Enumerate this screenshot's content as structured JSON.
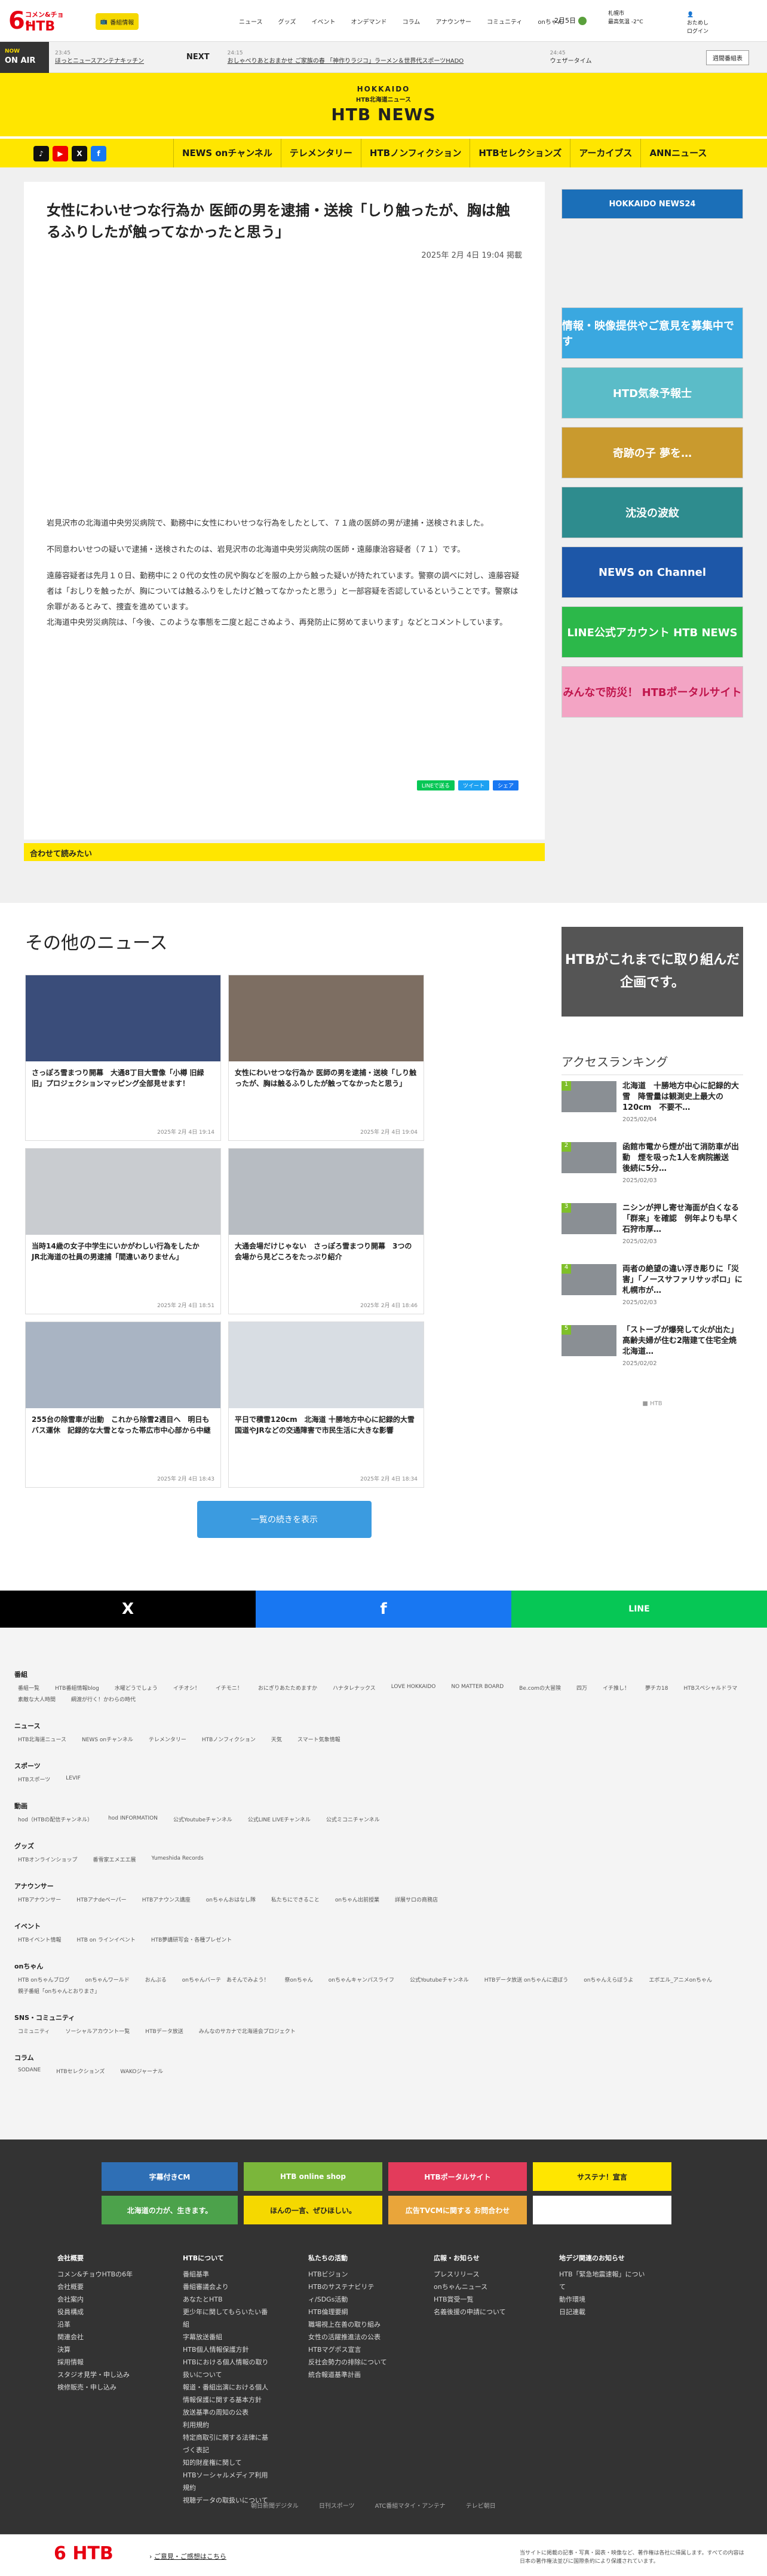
{
  "header": {
    "logo_six": "6",
    "logo_text": "コメン&チョウ",
    "logo_htb": "HTB",
    "member_label": "番組情報",
    "nav": [
      "ニュース",
      "グッズ",
      "イベント",
      "オンデマンド",
      "コラム",
      "アナウンサー",
      "コミュニティ",
      "onちゃん"
    ],
    "date": "2月5日",
    "weather_city": "札幌市",
    "weather_info": "最高気温 -2°C",
    "login_label": "ログイン",
    "login_sub": "おためし"
  },
  "onair": {
    "label_top": "NOW",
    "label": "ON AIR",
    "now_time": "23:45",
    "now_title": "ほっとニュースアンテナキッチン",
    "next_label": "NEXT",
    "next_time": "24:15",
    "next_title": "おしゃべりあとおまかせ ご家族の春 「神作りラジコ」ラーメン＆世界代スポーツHADO",
    "next2_time": "24:45",
    "next2_title": "ウェザータイム",
    "program_button": "週間番組表"
  },
  "banner": {
    "hokkaido": "HOKKAIDO",
    "sub": "HTB北海道ニュース",
    "title": "HTB NEWS"
  },
  "nav_main": [
    "NEWS onチャンネル",
    "テレメンタリー",
    "HTBノンフィクション",
    "HTBセレクションズ",
    "アーカイブス",
    "ANNニュース"
  ],
  "social": {
    "tiktok": "TikTok",
    "youtube": "YouTube",
    "x": "X",
    "facebook": "Facebook"
  },
  "article": {
    "title": "女性にわいせつな行為か 医師の男を逮捕・送検「しり触ったが、胸は触るふりしたが触ってなかったと思う」",
    "published": "2025年 2月 4日 19:04 掲載",
    "p1": "岩見沢市の北海道中央労災病院で、勤務中に女性にわいせつな行為をしたとして、７１歳の医師の男が逮捕・送検されました。",
    "p2": "不同意わいせつの疑いで逮捕・送検されたのは、岩見沢市の北海道中央労災病院の医師・遠藤康治容疑者（７１）です。",
    "p3": "遠藤容疑者は先月１０日、勤務中に２０代の女性の尻や胸などを服の上から触った疑いが持たれています。警察の調べに対し、遠藤容疑者は「おしりを触ったが、胸については触るふりをしたけど触ってなかったと思う」と一部容疑を否認しているということです。警察は余罪があるとみて、捜査を進めています。",
    "p4": "北海道中央労災病院は、「今後、このような事態を二度と起こさぬよう、再発防止に努めてまいります」などとコメントしています。",
    "share_line": "LINEで送る",
    "share_x": "ツイート",
    "share_fb": "シェア",
    "related_label": "合わせて読みたい"
  },
  "sidebar_banners": [
    "HOKKAIDO NEWS24",
    "情報・映像提供やご意見を募集中です",
    "HTD気象予報士",
    "奇跡の子 夢を…",
    "沈没の波紋",
    "NEWS on Channel",
    "LINE公式アカウント HTB NEWS",
    "みんなで防災！ HTBポータルサイト"
  ],
  "other_news": {
    "heading": "その他のニュース",
    "items": [
      {
        "title": "さっぽろ雪まつり開幕　大通8丁目大雪像「小樽 旧緑旧」プロジェクションマッピング全部見せます！",
        "date": "2025年 2月 4日 19:14"
      },
      {
        "title": "女性にわいせつな行為か 医師の男を逮捕・送検「しり触ったが、胸は触るふりしたが触ってなかったと思う」",
        "date": "2025年 2月 4日 19:04"
      },
      {
        "title": "当時14歳の女子中学生にいかがわしい行為をしたか　JR北海道の社員の男逮捕「間違いありません」",
        "date": "2025年 2月 4日 18:51"
      },
      {
        "title": "大通会場だけじゃない　さっぽろ雪まつり開幕　3つの会場から見どころをたっぷり紹介",
        "date": "2025年 2月 4日 18:46"
      },
      {
        "title": "255台の除雪車が出動　これから除雪2週目へ　明日もバス運休　記録的な大雪となった帯広市中心部から中継",
        "date": "2025年 2月 4日 18:43"
      },
      {
        "title": "平日で積雪120cm　北海道 十勝地方中心に記録的大雪　国道やJRなどの交通障害で市民生活に大きな影響",
        "date": "2025年 2月 4日 18:34"
      }
    ],
    "more_label": "一覧の続きを表示"
  },
  "promo": {
    "text": "HTBがこれまでに取り組んだ企画です。"
  },
  "ranking": {
    "heading": "アクセスランキング",
    "items": [
      {
        "rank": "1",
        "title": "北海道　十勝地方中心に記録的大雪　降雪量は観測史上最大の120cm　不要不…",
        "date": "2025/02/04"
      },
      {
        "rank": "2",
        "title": "函館市電から煙が出て消防車が出動　煙を吸った1人を病院搬送　後続に5分…",
        "date": "2025/02/03"
      },
      {
        "rank": "3",
        "title": "ニシンが押し寄せ海面が白くなる「群来」を確認　例年よりも早く　石狩市厚…",
        "date": "2025/02/03"
      },
      {
        "rank": "4",
        "title": "両者の絶望の違い浮き彫りに「災害」「ノースサファリサッポロ」に札幌市が…",
        "date": "2025/02/03"
      },
      {
        "rank": "5",
        "title": "「ストーブが爆発して火が出た」高齢夫婦が住む2階建て住宅全焼　北海道…",
        "date": "2025/02/02"
      }
    ],
    "powered": "HTB"
  },
  "sharebar": {
    "x": "X",
    "facebook": "f",
    "line": "LINE"
  },
  "sitemap": [
    {
      "h": "番組",
      "links": [
        "番組一覧",
        "HTB番組情報blog",
        "水曜どうでしょう",
        "イチオシ！",
        "イチモニ！",
        "おにぎりあたためますか",
        "ハナタレナックス",
        "LOVE HOKKAIDO",
        "NO MATTER BOARD",
        "Be.comの大冒険",
        "四万",
        "イチ推し！",
        "夢チカ18",
        "HTBスペシャルドラマ",
        "素敵な大人時間",
        "綱渡が行く！かわらの時代"
      ]
    },
    {
      "h": "ニュース",
      "links": [
        "HTB北海道ニュース",
        "NEWS onチャンネル",
        "テレメンタリー",
        "HTBノンフィクション",
        "天気",
        "スマート気象情報"
      ]
    },
    {
      "h": "スポーツ",
      "links": [
        "HTBスポーツ",
        "LEVIF"
      ]
    },
    {
      "h": "動画",
      "links": [
        "hod（HTBの配信チャンネル）",
        "hod INFORMATION",
        "公式Youtubeチャンネル",
        "公式LINE LIVEチャンネル",
        "公式ミコニチャンネル"
      ]
    },
    {
      "h": "グッズ",
      "links": [
        "HTBオンラインショップ",
        "番雪家エメエエ展",
        "Yumeshida Records"
      ]
    },
    {
      "h": "アナウンサー",
      "links": [
        "HTBアナウンサー",
        "HTBアナdeべーパー",
        "HTBアナウンス講座",
        "onちゃんおはなし隊",
        "私たちにできること",
        "onちゃん出前授業",
        "詳展サロの商務店"
      ]
    },
    {
      "h": "イベント",
      "links": [
        "HTBイベント情報",
        "HTB on ラインイベント",
        "HTB夢講研写会・各種プレゼント"
      ]
    },
    {
      "h": "onちゃん",
      "links": [
        "HTB onちゃんブログ",
        "onちゃんワールド",
        "おんぷる",
        "onちゃんバーテ　あそんでみよう！",
        "祭onちゃん",
        "onちゃんキャンパスライフ",
        "公式Youtubeチャンネル",
        "HTBデータ放送 onちゃんに遊ぼう",
        "onちゃんえらぼうよ",
        "エボエル_アニメonちゃん",
        "親子番組「onちゃんとおりまさ」"
      ]
    },
    {
      "h": "SNS・コミュニティ",
      "links": [
        "コミュニティ",
        "ソーシャルアカウント一覧",
        "HTBデータ放送",
        "みんなのサカナで北海道会プロジェクト"
      ]
    },
    {
      "h": "コラム",
      "links": [
        "SODANE",
        "HTBセレクションズ",
        "WAKOジャーナル"
      ]
    }
  ],
  "footer_banners": [
    "字幕付きCM",
    "HTB online shop",
    "HTBポータルサイト",
    "サステナ！宣言",
    "北海道の力が、生きます。",
    "ほんの一言、ぜひほしい。",
    "広告TVCMに関する お問合わせ",
    ""
  ],
  "footer_cols": [
    {
      "h": "会社概要",
      "links": [
        "コメン&チョウHTBの6年",
        "会社概要",
        "会社案内",
        "役員構成",
        "沿革",
        "関連会社",
        "決算",
        "採用情報",
        "スタジオ見学・申し込み",
        "検修販売・申し込み"
      ]
    },
    {
      "h": "HTBについて",
      "links": [
        "番組基準",
        "番組審議会より",
        "あなたとHTB",
        "更少年に関してもらいたい番組",
        "字幕放送番組",
        "HTB個人情報保護方針",
        "HTBにおける個人情報の取り扱いについて",
        "報道・番組出演における個人情報保護に関する基本方針",
        "放送基準の周知の公表",
        "利用規約",
        "特定商取引に関する法律に基づく表記",
        "知的財産権に関して",
        "HTBソーシャルメディア利用規約",
        "視聴データの取扱いについて"
      ]
    },
    {
      "h": "私たちの活動",
      "links": [
        "HTBビジョン",
        "HTBのサステナビリティ/SDGs活動",
        "HTB倫理要綱",
        "職場視上在善の取り組み",
        "女性の活躍推進法の公表",
        "HTBマグポス宣言",
        "反社会勢力の排除について",
        "統合報道基準計画"
      ]
    },
    {
      "h": "広報・お知らせ",
      "links": [
        "プレスリリース",
        "onちゃんニュース",
        "HTB賞受一覧",
        "名義後援の申請について"
      ]
    },
    {
      "h": "地デジ関連のお知らせ",
      "links": [
        "HTB「緊急地震速報」について",
        "",
        "動作環境",
        "",
        "日記連載"
      ]
    }
  ],
  "footer_bottom": [
    "朝日新聞デジタル",
    "日刊スポーツ",
    "ATC番組マタイ・アンテナ",
    "テレビ朝日"
  ],
  "foot2": {
    "logo": "6 HTB",
    "link": "ご意見・ご感想はこちら",
    "copyright": "当サイトに掲載の記事・写真・図表・映像など、著作権は各社に帰属します。すべての内容は日本の著作権法並びに国際条約により保護されています。"
  },
  "colors": {
    "brand_red": "#e60012",
    "brand_yellow": "#ffe600",
    "link_blue": "#3b9be0"
  }
}
